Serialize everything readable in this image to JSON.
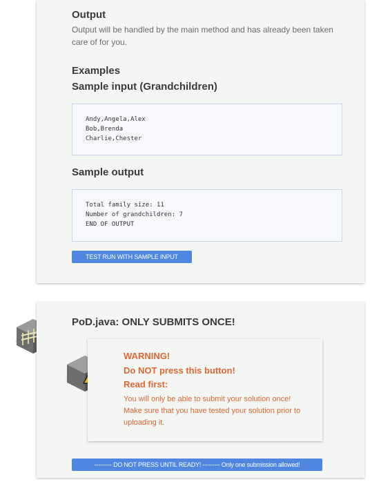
{
  "output_section": {
    "heading": "Output",
    "description": "Output will be handled by the main method and has already been taken care of for you."
  },
  "examples_section": {
    "heading": "Examples",
    "input_heading": "Sample input (Grandchildren)",
    "input_lines": [
      "Andy,Angela,Alex",
      "Bob,Brenda",
      "Charlie,Chester"
    ],
    "output_heading": "Sample output",
    "output_lines": [
      "Total family size: 11",
      "Number of grandchildren: 7",
      "END OF OUTPUT"
    ],
    "test_button_label": "TEST RUN WITH SAMPLE INPUT"
  },
  "submission_section": {
    "title": "PoD.java: ONLY SUBMITS ONCE!",
    "warning": {
      "line1": "WARNING!",
      "line2": "Do NOT press this button!",
      "line3": "Read first:",
      "body": "You will only be able to submit your solution once! Make sure that you have tested your solution prior to uploading it."
    },
    "submit_button_label": "--------- DO NOT PRESS UNTIL READY! --------- Only one submission allowed!"
  },
  "colors": {
    "accent": "#4e86e0",
    "warning": "#dd6633",
    "card_background": "#f3f6f3"
  },
  "icons": [
    "fence-icon",
    "warning-icon"
  ]
}
